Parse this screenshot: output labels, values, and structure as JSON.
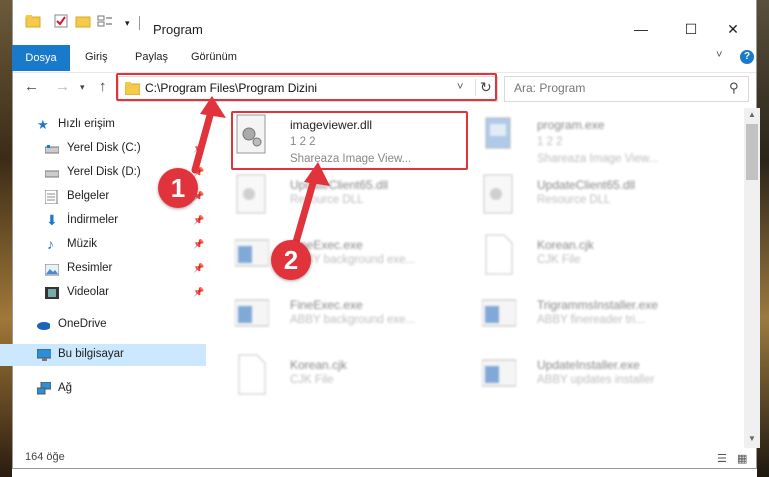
{
  "window": {
    "title": "Program",
    "minimize_glyph": "—",
    "maximize_glyph": "☐",
    "close_glyph": "✕"
  },
  "ribbon": {
    "tabs": [
      "Dosya",
      "Giriş",
      "Paylaş",
      "Görünüm"
    ],
    "active_tab": "Dosya",
    "help_glyph": "?",
    "expand_glyph": "˅"
  },
  "nav": {
    "address": "C:\\Program Files\\Program Dizini",
    "search_placeholder": "Ara: Program"
  },
  "sidebar": {
    "items": [
      {
        "label": "Hızlı erişim",
        "icon": "star-icon",
        "pinned": false
      },
      {
        "label": "Yerel Disk (C:)",
        "icon": "drive-icon",
        "pinned": true
      },
      {
        "label": "Yerel Disk (D:)",
        "icon": "drive-icon",
        "pinned": true
      },
      {
        "label": "Belgeler",
        "icon": "documents-icon",
        "pinned": true
      },
      {
        "label": "İndirmeler",
        "icon": "download-icon",
        "pinned": true
      },
      {
        "label": "Müzik",
        "icon": "music-icon",
        "pinned": true
      },
      {
        "label": "Resimler",
        "icon": "pictures-icon",
        "pinned": true
      },
      {
        "label": "Videolar",
        "icon": "videos-icon",
        "pinned": true
      },
      {
        "label": "OneDrive",
        "icon": "cloud-icon",
        "pinned": false
      },
      {
        "label": "Bu bilgisayar",
        "icon": "computer-icon",
        "pinned": false,
        "selected": true
      },
      {
        "label": "Ağ",
        "icon": "network-icon",
        "pinned": false
      }
    ]
  },
  "files": [
    {
      "name": "imageviewer.dll",
      "line2": "1 2 2",
      "line3": "Shareaza Image View...",
      "icon": "dll-icon",
      "highlighted": true
    },
    {
      "name": "program.exe",
      "line2": "1 2 2",
      "line3": "Shareaza Image View...",
      "icon": "exe-icon"
    },
    {
      "name": "UpdateClient65.dll",
      "line2": "Resource DLL",
      "icon": "dll-icon"
    },
    {
      "name": "UpdateClient65.dll",
      "line2": "Resource DLL",
      "icon": "dll-icon"
    },
    {
      "name": "FineExec.exe",
      "line2": "ABBY background exe...",
      "icon": "app-icon"
    },
    {
      "name": "Korean.cjk",
      "line2": "CJK File",
      "icon": "file-icon"
    },
    {
      "name": "FineExec.exe",
      "line2": "ABBY background exe...",
      "icon": "app-icon"
    },
    {
      "name": "TrigrammsInstaller.exe",
      "line2": "ABBY finereader tri...",
      "icon": "app-icon"
    },
    {
      "name": "Korean.cjk",
      "line2": "CJK File",
      "icon": "file-icon"
    },
    {
      "name": "UpdateInstaller.exe",
      "line2": "ABBY updates installer",
      "icon": "app-icon"
    }
  ],
  "status": {
    "item_count": "164 öğe"
  },
  "annotations": {
    "badge1": "1",
    "badge2": "2"
  },
  "colors": {
    "accent": "#1979ca",
    "highlight_red": "#e0333b",
    "selected_bg": "#cce8ff"
  }
}
